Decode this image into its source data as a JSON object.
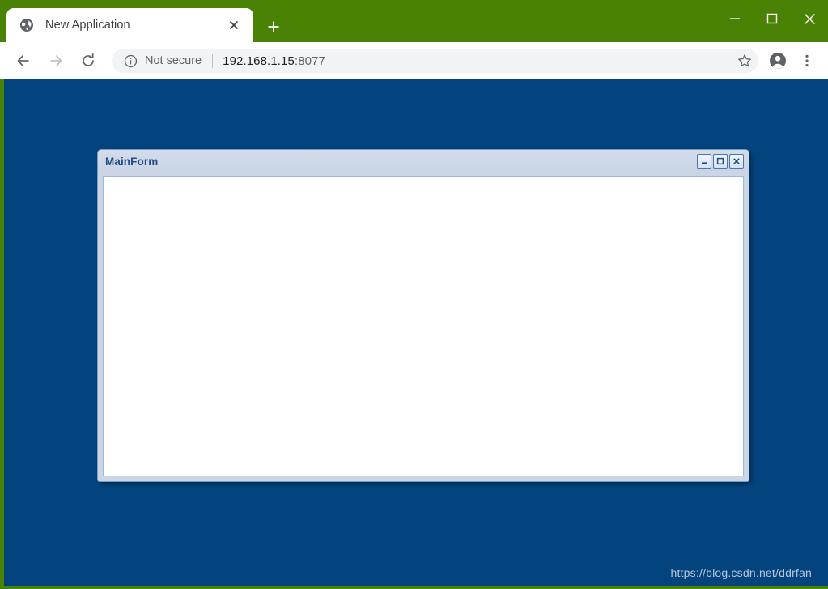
{
  "browser": {
    "tab": {
      "title": "New Application",
      "favicon": "globe-icon",
      "close_label": "×"
    },
    "new_tab_label": "+",
    "window_controls": {
      "minimize": "minimize-icon",
      "maximize": "maximize-icon",
      "close": "close-icon"
    },
    "toolbar": {
      "back": "back-arrow-icon",
      "forward": "forward-arrow-icon",
      "reload": "reload-icon",
      "security_icon": "info-circle-icon",
      "security_text": "Not secure",
      "url_host": "192.168.1.15",
      "url_port": ":8077",
      "bookmark": "star-icon",
      "profile": "account-avatar-icon",
      "menu": "three-dot-menu-icon"
    }
  },
  "page": {
    "background_color": "#03447f",
    "mainform": {
      "title": "MainForm",
      "titlebar_color": "#cbd6e5",
      "title_color": "#1f4e87",
      "client_background": "#ffffff",
      "buttons": {
        "minimize": "minimize-icon",
        "maximize": "maximize-icon",
        "close": "close-icon"
      }
    },
    "watermark": "https://blog.csdn.net/ddrfan"
  },
  "colors": {
    "browser_chrome": "#4a8206",
    "page_background": "#03447f",
    "form_titlebar": "#cbd6e5",
    "form_border": "#7a9cc6"
  }
}
